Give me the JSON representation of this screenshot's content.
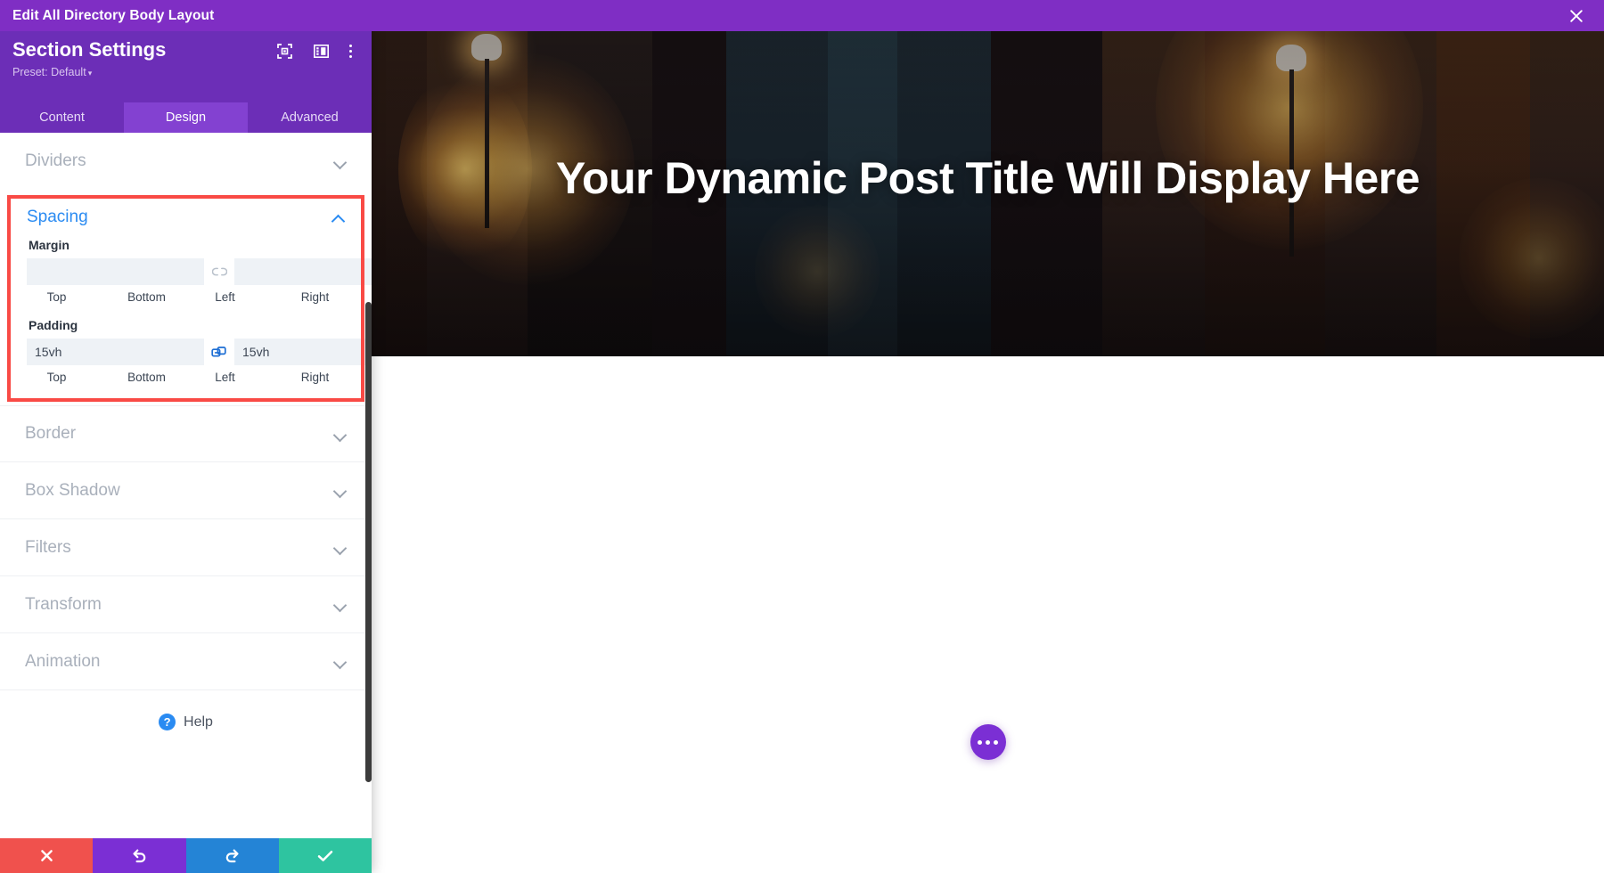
{
  "window": {
    "title": "Edit All Directory Body Layout",
    "close_icon": "close-icon"
  },
  "panel": {
    "header": {
      "title": "Section Settings",
      "preset_label": "Preset: Default",
      "icons": [
        {
          "name": "focus-target-icon"
        },
        {
          "name": "layout-columns-icon"
        },
        {
          "name": "more-vertical-icon"
        }
      ]
    },
    "tabs": [
      {
        "label": "Content",
        "active": false
      },
      {
        "label": "Design",
        "active": true
      },
      {
        "label": "Advanced",
        "active": false
      }
    ],
    "sections_above": [
      {
        "label": "Dividers",
        "state": "collapsed"
      }
    ],
    "spacing": {
      "label": "Spacing",
      "state": "expanded",
      "highlighted": true,
      "highlight_color": "#f94a45",
      "accent_color": "#2a8bf2",
      "groups": [
        {
          "name": "Margin",
          "label": "Margin",
          "fields": [
            {
              "side": "Top",
              "value": "",
              "placeholder": ""
            },
            {
              "side": "Bottom",
              "value": "",
              "placeholder": ""
            },
            {
              "side": "Left",
              "value": "",
              "placeholder": ""
            },
            {
              "side": "Right",
              "value": "",
              "placeholder": ""
            }
          ],
          "link_left": {
            "icon": "link-broken-icon",
            "linked": false
          },
          "link_right": {
            "icon": "link-broken-icon",
            "linked": false
          }
        },
        {
          "name": "Padding",
          "label": "Padding",
          "fields": [
            {
              "side": "Top",
              "value": "15vh",
              "placeholder": ""
            },
            {
              "side": "Bottom",
              "value": "15vh",
              "placeholder": ""
            },
            {
              "side": "Left",
              "value": "",
              "placeholder": ""
            },
            {
              "side": "Right",
              "value": "",
              "placeholder": ""
            }
          ],
          "link_left": {
            "icon": "link-connected-icon",
            "linked": true
          },
          "link_right": {
            "icon": "link-broken-icon",
            "linked": false
          }
        }
      ]
    },
    "sections_below": [
      {
        "label": "Border",
        "state": "collapsed"
      },
      {
        "label": "Box Shadow",
        "state": "collapsed"
      },
      {
        "label": "Filters",
        "state": "collapsed"
      },
      {
        "label": "Transform",
        "state": "collapsed"
      },
      {
        "label": "Animation",
        "state": "collapsed"
      }
    ],
    "help": {
      "label": "Help",
      "badge": "?",
      "icon": "question-circle-icon"
    },
    "actions": [
      {
        "name": "cancel-button",
        "icon": "close-icon",
        "color": "#f0514d"
      },
      {
        "name": "undo-button",
        "icon": "undo-icon",
        "color": "#7b2fd4"
      },
      {
        "name": "redo-button",
        "icon": "redo-icon",
        "color": "#2484d6"
      },
      {
        "name": "save-button",
        "icon": "check-icon",
        "color": "#2ec4a0"
      }
    ]
  },
  "preview": {
    "hero": {
      "title": "Your Dynamic Post Title Will Display Here",
      "alt": "night city street with glowing street lamps"
    },
    "fab": {
      "name": "page-settings-button",
      "icon": "ellipsis-icon",
      "color": "#7b2fd4"
    }
  }
}
